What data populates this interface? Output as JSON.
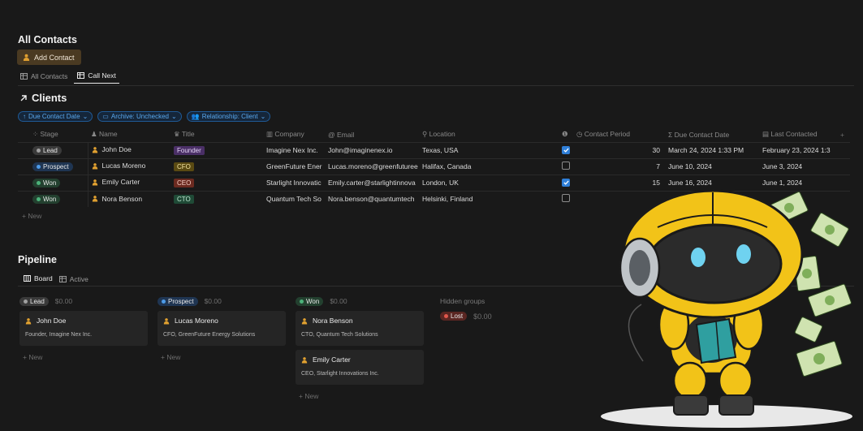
{
  "header": {
    "title": "All Contacts",
    "add_button": "Add Contact"
  },
  "tabs": [
    {
      "label": "All Contacts"
    },
    {
      "label": "Call Next"
    }
  ],
  "clients": {
    "title": "Clients",
    "filters": [
      "Due Contact Date",
      "Archive: Unchecked",
      "Relationship: Client"
    ],
    "columns": [
      "Stage",
      "Name",
      "Title",
      "Company",
      "Email",
      "Location",
      "Contact Period",
      "Due Contact Date",
      "Last Contacted"
    ],
    "rows": [
      {
        "stage": "Lead",
        "name": "John Doe",
        "title": "Founder",
        "company": "Imagine Nex Inc.",
        "email": "John@imaginenex.io",
        "location": "Texas, USA",
        "checked": true,
        "period": "30",
        "due": "March 24, 2024 1:33 PM",
        "last": "February 23, 2024 1:3"
      },
      {
        "stage": "Prospect",
        "name": "Lucas Moreno",
        "title": "CFO",
        "company": "GreenFuture Ener",
        "email": "Lucas.moreno@greenfuturee",
        "location": "Halifax, Canada",
        "checked": false,
        "period": "7",
        "due": "June 10, 2024",
        "last": "June 3, 2024"
      },
      {
        "stage": "Won",
        "name": "Emily Carter",
        "title": "CEO",
        "company": "Starlight Innovatic",
        "email": "Emily.carter@starlightinnova",
        "location": "London, UK",
        "checked": true,
        "period": "15",
        "due": "June 16, 2024",
        "last": "June 1, 2024"
      },
      {
        "stage": "Won",
        "name": "Nora Benson",
        "title": "CTO",
        "company": "Quantum Tech So",
        "email": "Nora.benson@quantumtech",
        "location": "Helsinki, Finland",
        "checked": false,
        "period": "",
        "due": "",
        "last": ""
      }
    ],
    "new_label": "New"
  },
  "pipeline": {
    "title": "Pipeline",
    "tabs": [
      {
        "label": "Board"
      },
      {
        "label": "Active"
      }
    ],
    "columns": [
      {
        "label": "Lead",
        "amount": "$0.00",
        "cards": [
          {
            "name": "John Doe",
            "sub": "Founder, Imagine Nex Inc."
          }
        ]
      },
      {
        "label": "Prospect",
        "amount": "$0.00",
        "cards": [
          {
            "name": "Lucas Moreno",
            "sub": "CFO, GreenFuture Energy Solutions"
          }
        ]
      },
      {
        "label": "Won",
        "amount": "$0.00",
        "cards": [
          {
            "name": "Nora Benson",
            "sub": "CTO, Quantum Tech Solutions"
          },
          {
            "name": "Emily Carter",
            "sub": "CEO, Starlight Innovations Inc."
          }
        ]
      }
    ],
    "hidden_groups": "Hidden groups",
    "lost": {
      "label": "Lost",
      "amount": "$0.00"
    },
    "new_label": "New"
  },
  "colors": {
    "background": "#191919",
    "accent_blue": "#2f7fd8",
    "robot_yellow": "#f2c318"
  }
}
